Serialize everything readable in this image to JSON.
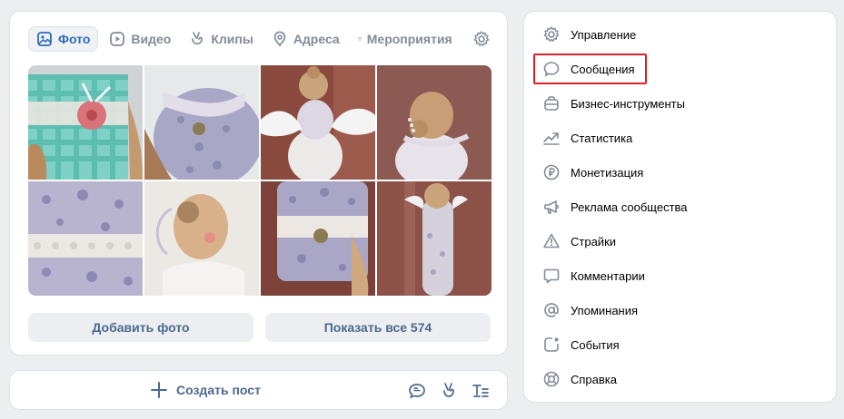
{
  "media": {
    "tabs": [
      {
        "label": "Фото",
        "icon": "photo-icon",
        "active": true
      },
      {
        "label": "Видео",
        "icon": "video-icon"
      },
      {
        "label": "Клипы",
        "icon": "clips-icon"
      },
      {
        "label": "Адреса",
        "icon": "location-icon"
      },
      {
        "label": "Мероприятия",
        "icon": "calendar-icon"
      }
    ],
    "add_photo_label": "Добавить фото",
    "show_all_label": "Показать все 574"
  },
  "post": {
    "create_label": "Создать пост"
  },
  "menu": {
    "items": [
      {
        "label": "Управление",
        "icon": "gear-icon"
      },
      {
        "label": "Сообщения",
        "icon": "message-icon",
        "highlighted": true
      },
      {
        "label": "Бизнес-инструменты",
        "icon": "briefcase-icon"
      },
      {
        "label": "Статистика",
        "icon": "trend-icon"
      },
      {
        "label": "Монетизация",
        "icon": "ruble-icon"
      },
      {
        "label": "Реклама сообщества",
        "icon": "megaphone-icon"
      },
      {
        "label": "Страйки",
        "icon": "warning-icon"
      },
      {
        "label": "Комментарии",
        "icon": "comment-icon"
      },
      {
        "label": "Упоминания",
        "icon": "at-icon"
      },
      {
        "label": "События",
        "icon": "event-icon"
      },
      {
        "label": "Справка",
        "icon": "help-icon"
      }
    ]
  },
  "colors": {
    "accent": "#2d6cbe",
    "button_text": "#4b6a8f",
    "highlight_border": "#e0202a"
  }
}
